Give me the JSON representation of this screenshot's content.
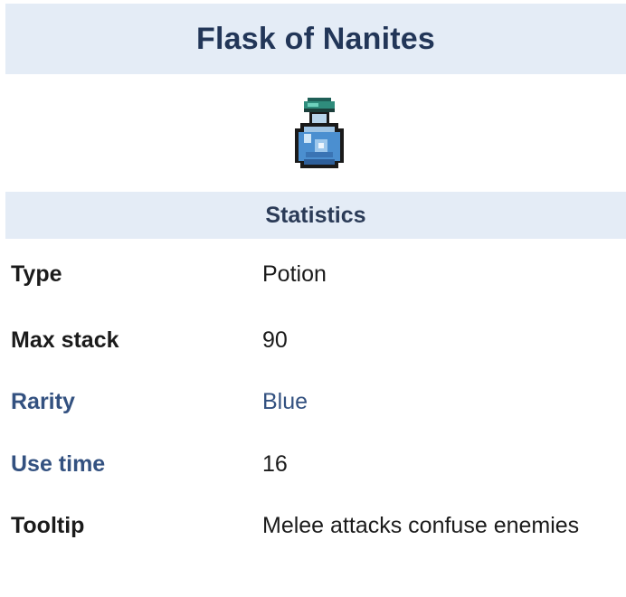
{
  "item": {
    "title": "Flask of Nanites",
    "icon": "flask-icon"
  },
  "statistics": {
    "header": "Statistics",
    "rows": [
      {
        "label": "Type",
        "value": "Potion"
      },
      {
        "label": "Max stack",
        "value": "90"
      },
      {
        "label": "Rarity",
        "value": "Blue"
      },
      {
        "label": "Use time",
        "value": "16"
      },
      {
        "label": "Tooltip",
        "value": "Melee attacks confuse enemies"
      }
    ]
  },
  "colors": {
    "header_bg": "#e4ecf6",
    "title_text": "#223658",
    "link_text": "#335180",
    "body_text": "#1b1b1b"
  }
}
